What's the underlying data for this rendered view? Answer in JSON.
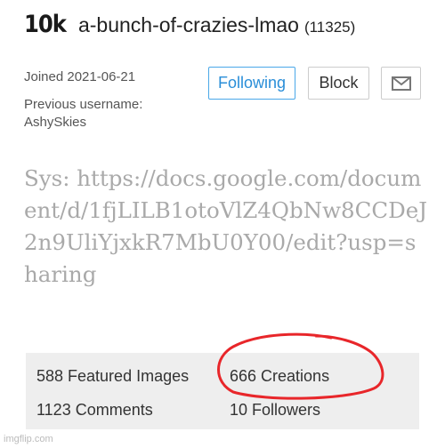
{
  "profile": {
    "badge": "10k",
    "username": "a-bunch-of-crazies-lmao",
    "points": "(11325)",
    "joined": "Joined 2021-06-21",
    "previous_label": "Previous username:",
    "previous_value": "AshySkies",
    "description": "Sys: https://docs.google.com/document/d/1fjLILB1otoVlZ4QbNw8CCDeJ2n9UliYjxkR7MbU0Y00/edit?usp=sharing"
  },
  "buttons": {
    "following": "Following",
    "block": "Block",
    "mail_icon": "envelope-icon"
  },
  "stats": {
    "featured": "588 Featured Images",
    "creations": "666 Creations",
    "comments": "1123 Comments",
    "followers": "10 Followers"
  },
  "annotation": {
    "color": "#e8262a"
  },
  "watermark": "imgflip.com"
}
